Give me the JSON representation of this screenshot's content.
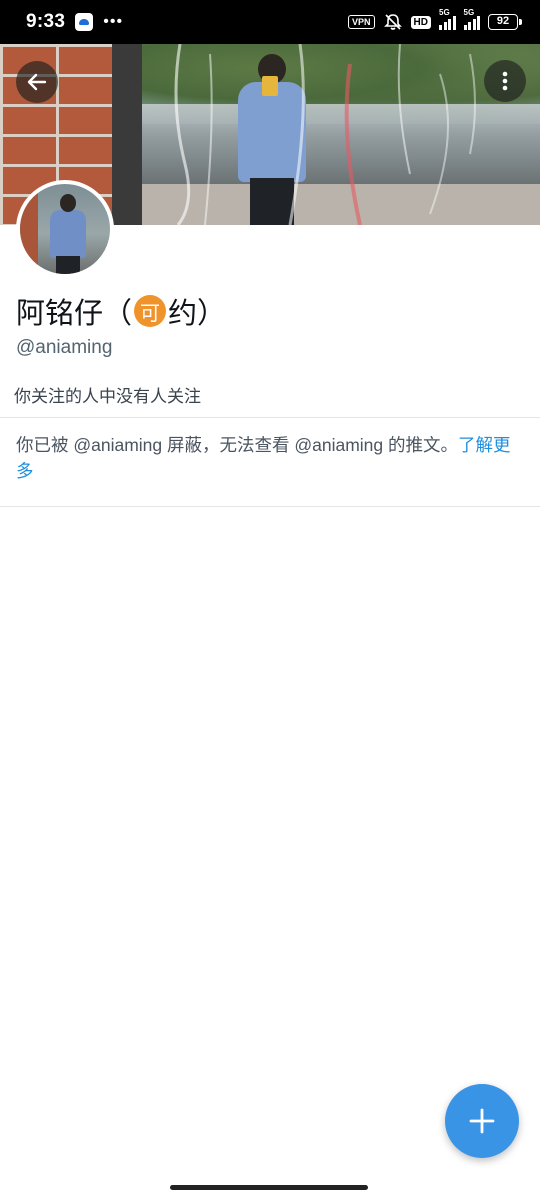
{
  "status_bar": {
    "time": "9:33",
    "dots": "•••",
    "vpn": "VPN",
    "hd": "HD",
    "signal1_label": "5G",
    "signal2_label": "5G",
    "battery": "92"
  },
  "profile": {
    "name_before": "阿铭仔（",
    "name_badge": "可",
    "name_after": "约）",
    "handle": "@aniaming",
    "bio": "你关注的人中没有人关注"
  },
  "blocked": {
    "message": "你已被 @aniaming 屏蔽，无法查看 @aniaming 的推文。",
    "learn_more": "了解更多"
  },
  "icons": {
    "back": "arrow-left-icon",
    "more": "more-vertical-icon",
    "fab": "plus-icon"
  },
  "colors": {
    "accent": "#1d8fe0",
    "fab": "#3a94e6",
    "badge": "#f0932b"
  }
}
